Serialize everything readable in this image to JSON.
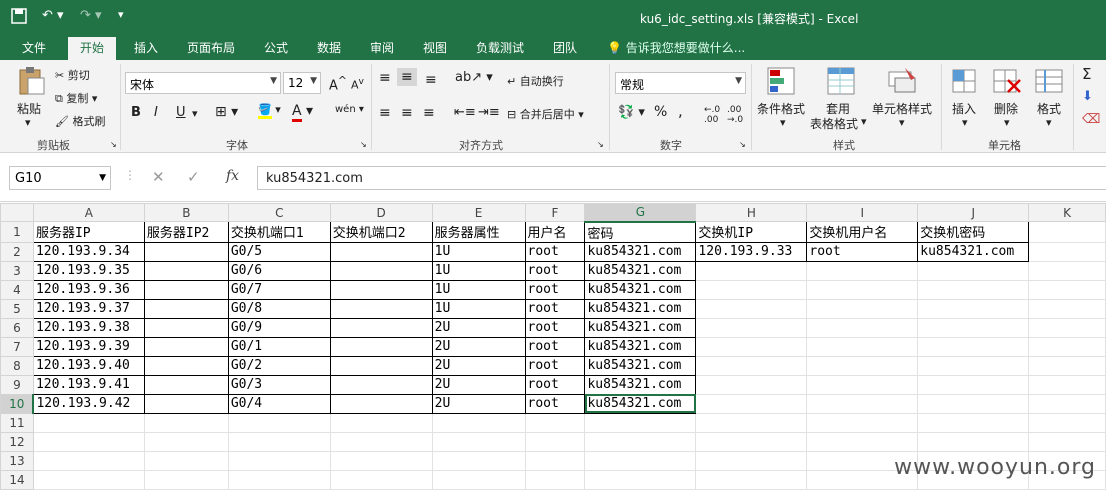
{
  "titlebar": {
    "title": "ku6_idc_setting.xls  [兼容模式] - Excel",
    "save_icon": "save-icon",
    "undo_icon": "undo-icon",
    "redo_icon": "redo-icon"
  },
  "tabs": [
    {
      "label": "文件"
    },
    {
      "label": "开始"
    },
    {
      "label": "插入"
    },
    {
      "label": "页面布局"
    },
    {
      "label": "公式"
    },
    {
      "label": "数据"
    },
    {
      "label": "审阅"
    },
    {
      "label": "视图"
    },
    {
      "label": "负载测试"
    },
    {
      "label": "团队"
    }
  ],
  "tell_me": "告诉我您想要做什么...",
  "ribbon": {
    "clipboard": {
      "paste": "粘贴",
      "cut": "剪切",
      "copy": "复制",
      "format_painter": "格式刷",
      "label": "剪贴板"
    },
    "font": {
      "name": "宋体",
      "size": "12",
      "bold": "B",
      "italic": "I",
      "underline": "U",
      "label": "字体"
    },
    "alignment": {
      "wrap": "自动换行",
      "merge": "合并后居中",
      "label": "对齐方式"
    },
    "number": {
      "format": "常规",
      "label": "数字"
    },
    "styles": {
      "conditional": "条件格式",
      "table_fmt": "套用",
      "table_fmt2": "表格格式",
      "cell_styles": "单元格样式",
      "label": "样式"
    },
    "cells": {
      "insert": "插入",
      "delete": "删除",
      "format": "格式",
      "label": "单元格"
    }
  },
  "formula_bar": {
    "name_box": "G10",
    "formula": "ku854321.com"
  },
  "columns": [
    "A",
    "B",
    "C",
    "D",
    "E",
    "F",
    "G",
    "H",
    "I",
    "J",
    "K"
  ],
  "rows": [
    [
      "服务器IP",
      "服务器IP2",
      "交换机端口1",
      "交换机端口2",
      "服务器属性",
      "用户名",
      "密码",
      "交换机IP",
      "交换机用户名",
      "交换机密码",
      ""
    ],
    [
      "120.193.9.34",
      "",
      "G0/5",
      "",
      "1U",
      "root",
      "ku854321.com",
      "120.193.9.33",
      "root",
      "ku854321.com",
      ""
    ],
    [
      "120.193.9.35",
      "",
      "G0/6",
      "",
      "1U",
      "root",
      "ku854321.com",
      "",
      "",
      "",
      ""
    ],
    [
      "120.193.9.36",
      "",
      "G0/7",
      "",
      "1U",
      "root",
      "ku854321.com",
      "",
      "",
      "",
      ""
    ],
    [
      "120.193.9.37",
      "",
      "G0/8",
      "",
      "1U",
      "root",
      "ku854321.com",
      "",
      "",
      "",
      ""
    ],
    [
      "120.193.9.38",
      "",
      "G0/9",
      "",
      "2U",
      "root",
      "ku854321.com",
      "",
      "",
      "",
      ""
    ],
    [
      "120.193.9.39",
      "",
      "G0/1",
      "",
      "2U",
      "root",
      "ku854321.com",
      "",
      "",
      "",
      ""
    ],
    [
      "120.193.9.40",
      "",
      "G0/2",
      "",
      "2U",
      "root",
      "ku854321.com",
      "",
      "",
      "",
      ""
    ],
    [
      "120.193.9.41",
      "",
      "G0/3",
      "",
      "2U",
      "root",
      "ku854321.com",
      "",
      "",
      "",
      ""
    ],
    [
      "120.193.9.42",
      "",
      "G0/4",
      "",
      "2U",
      "root",
      "ku854321.com",
      "",
      "",
      "",
      ""
    ],
    [
      "",
      "",
      "",
      "",
      "",
      "",
      "",
      "",
      "",
      "",
      ""
    ],
    [
      "",
      "",
      "",
      "",
      "",
      "",
      "",
      "",
      "",
      "",
      ""
    ],
    [
      "",
      "",
      "",
      "",
      "",
      "",
      "",
      "",
      "",
      "",
      ""
    ],
    [
      "",
      "",
      "",
      "",
      "",
      "",
      "",
      "",
      "",
      "",
      ""
    ]
  ],
  "watermark": "www.wooyun.org",
  "colors": {
    "accent": "#217346"
  }
}
